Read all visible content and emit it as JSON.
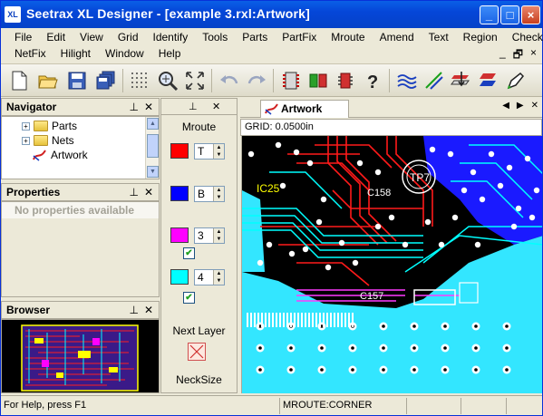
{
  "window": {
    "title": "Seetrax XL Designer - [example 3.rxl:Artwork]",
    "logo_text": "XL",
    "controls": [
      "_",
      "□",
      "×"
    ]
  },
  "menu": {
    "row1": [
      "File",
      "Edit",
      "View",
      "Grid",
      "Identify",
      "Tools",
      "Parts",
      "PartFix",
      "Mroute",
      "Amend",
      "Text",
      "Region",
      "Check"
    ],
    "row2": [
      "NetFix",
      "Hilight",
      "Window",
      "Help"
    ],
    "mdi_controls": [
      "_",
      "🗗",
      "×"
    ]
  },
  "toolbar": {
    "buttons": [
      "new-file",
      "open-folder",
      "save-disk",
      "save-all",
      "grid",
      "zoom-window",
      "zoom-fit",
      "undo",
      "redo",
      "part-a",
      "part-b",
      "part-c",
      "help",
      "route-a",
      "route-b",
      "layers",
      "layer-select",
      "edit-pen"
    ]
  },
  "navigator": {
    "title": "Navigator",
    "items": [
      {
        "label": "Parts",
        "expander": "+"
      },
      {
        "label": "Nets",
        "expander": "+"
      },
      {
        "label": "Artwork",
        "expander": ""
      }
    ]
  },
  "properties": {
    "title": "Properties",
    "empty_text": "No properties available"
  },
  "browser": {
    "title": "Browser"
  },
  "mroute": {
    "title": "Mroute",
    "layers": [
      {
        "color": "#ff0000",
        "value": "T",
        "checked": false
      },
      {
        "color": "#0000ff",
        "value": "B",
        "checked": false
      },
      {
        "color": "#ff00ff",
        "value": "3",
        "checked": true
      },
      {
        "color": "#00ffff",
        "value": "4",
        "checked": true
      }
    ],
    "next_layer_label": "Next Layer",
    "neck_size_label": "NeckSize"
  },
  "document": {
    "tab_label": "Artwork",
    "grid_label": "GRID:",
    "grid_value": "0.0500in",
    "canvas_labels": {
      "ic": "IC25",
      "tp": "TP7",
      "c158": "C158",
      "c157": "C157"
    }
  },
  "status": {
    "help": "For Help, press F1",
    "mode": "MROUTE:CORNER"
  },
  "colors": {
    "board_bg": "#000000",
    "copper_cyan": "#00ffff",
    "copper_red": "#ff0000",
    "copper_blue": "#0000ff",
    "copper_magenta": "#ff00ff",
    "silk_yellow": "#ffff00"
  }
}
